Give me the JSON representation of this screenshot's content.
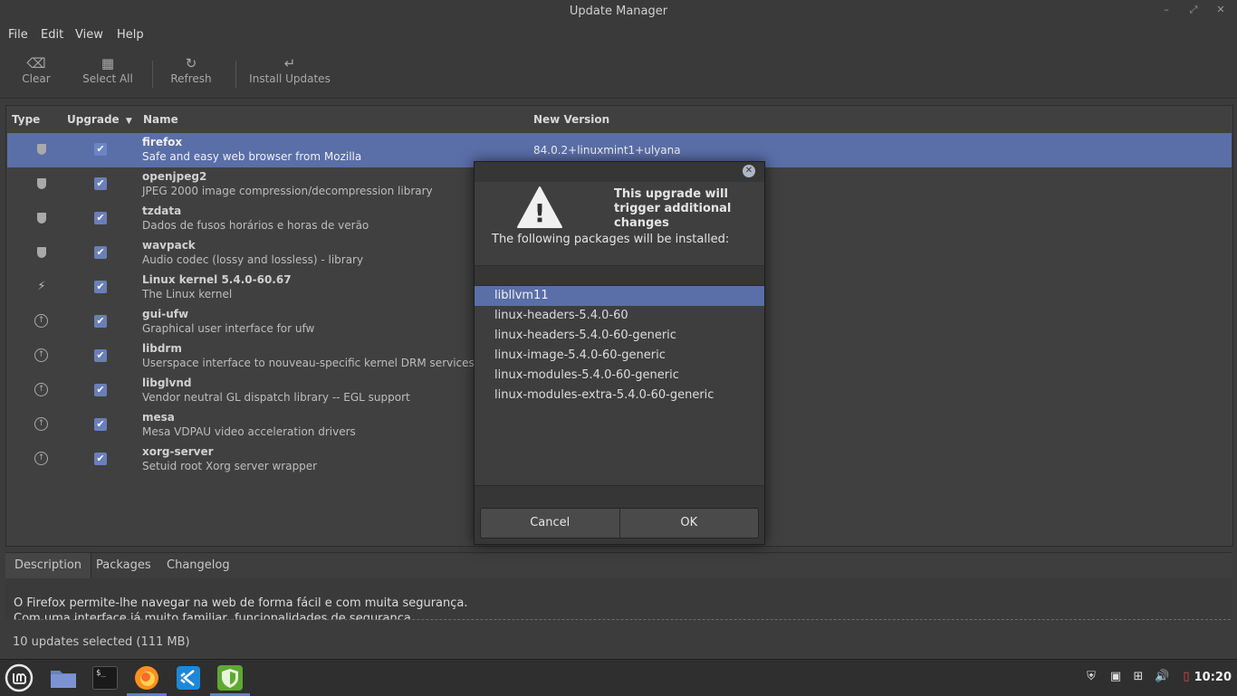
{
  "window": {
    "title": "Update Manager",
    "controls": [
      "–",
      "⤢",
      "✕"
    ]
  },
  "menu": [
    "File",
    "Edit",
    "View",
    "Help"
  ],
  "toolbar": {
    "clear": {
      "label": "Clear",
      "icon": "⌫"
    },
    "select_all": {
      "label": "Select All",
      "icon": "▦"
    },
    "refresh": {
      "label": "Refresh",
      "icon": "↻"
    },
    "install": {
      "label": "Install Updates",
      "icon": "↵"
    }
  },
  "columns": {
    "type": "Type",
    "upgrade": "Upgrade",
    "name": "Name",
    "version": "New Version"
  },
  "updates": [
    {
      "name": "firefox",
      "desc": "Safe and easy web browser from Mozilla",
      "version": "84.0.2+linuxmint1+ulyana",
      "type_icon": "shield-icon",
      "checked": "✔"
    },
    {
      "name": "openjpeg2",
      "desc": "JPEG 2000 image compression/decompression library",
      "version": "",
      "type_icon": "shield-icon",
      "checked": "✔"
    },
    {
      "name": "tzdata",
      "desc": "Dados de fusos horários e horas de verão",
      "version": "",
      "type_icon": "shield-icon",
      "checked": "✔"
    },
    {
      "name": "wavpack",
      "desc": "Audio codec (lossy and lossless) - library",
      "version": "",
      "type_icon": "shield-icon",
      "checked": "✔"
    },
    {
      "name": "Linux kernel 5.4.0-60.67",
      "desc": "The Linux kernel",
      "version": "",
      "type_icon": "lightning-icon",
      "checked": "✔"
    },
    {
      "name": "gui-ufw",
      "desc": "Graphical user interface for ufw",
      "version": "",
      "type_icon": "arrow-up-icon",
      "checked": "✔"
    },
    {
      "name": "libdrm",
      "desc": "Userspace interface to nouveau-specific kernel DRM services --",
      "version": "",
      "type_icon": "arrow-up-icon",
      "checked": "✔"
    },
    {
      "name": "libglvnd",
      "desc": "Vendor neutral GL dispatch library -- EGL support",
      "version": "",
      "type_icon": "arrow-up-icon",
      "checked": "✔"
    },
    {
      "name": "mesa",
      "desc": "Mesa VDPAU video acceleration drivers",
      "version": "",
      "type_icon": "arrow-up-icon",
      "checked": "✔"
    },
    {
      "name": "xorg-server",
      "desc": "Setuid root Xorg server wrapper",
      "version": "",
      "type_icon": "arrow-up-icon",
      "checked": "✔"
    }
  ],
  "tabs": [
    "Description",
    "Packages",
    "Changelog"
  ],
  "description": {
    "line1": "O Firefox permite-lhe navegar na web de forma fácil e com muita segurança.",
    "line2": "Com uma interface já muito familiar, funcionalidades de segurança"
  },
  "status": "10 updates selected (111 MB)",
  "dialog": {
    "close_icon": "✕",
    "warning_icon": "!",
    "title": "This upgrade will trigger additional changes",
    "message": "The following packages will be installed:",
    "packages": [
      "libllvm11",
      "linux-headers-5.4.0-60",
      "linux-headers-5.4.0-60-generic",
      "linux-image-5.4.0-60-generic",
      "linux-modules-5.4.0-60-generic",
      "linux-modules-extra-5.4.0-60-generic"
    ],
    "cancel": "Cancel",
    "ok": "OK"
  },
  "taskbar": {
    "apps": [
      "mint-menu-icon",
      "files-icon",
      "terminal-icon",
      "firefox-icon",
      "vscode-icon",
      "update-manager-icon"
    ],
    "terminal_glyph": "$_",
    "clock": "10:20"
  },
  "colors": {
    "selection": "#5a6ea8",
    "accent": "#5e7fc2",
    "mint": "#87cf3e"
  }
}
